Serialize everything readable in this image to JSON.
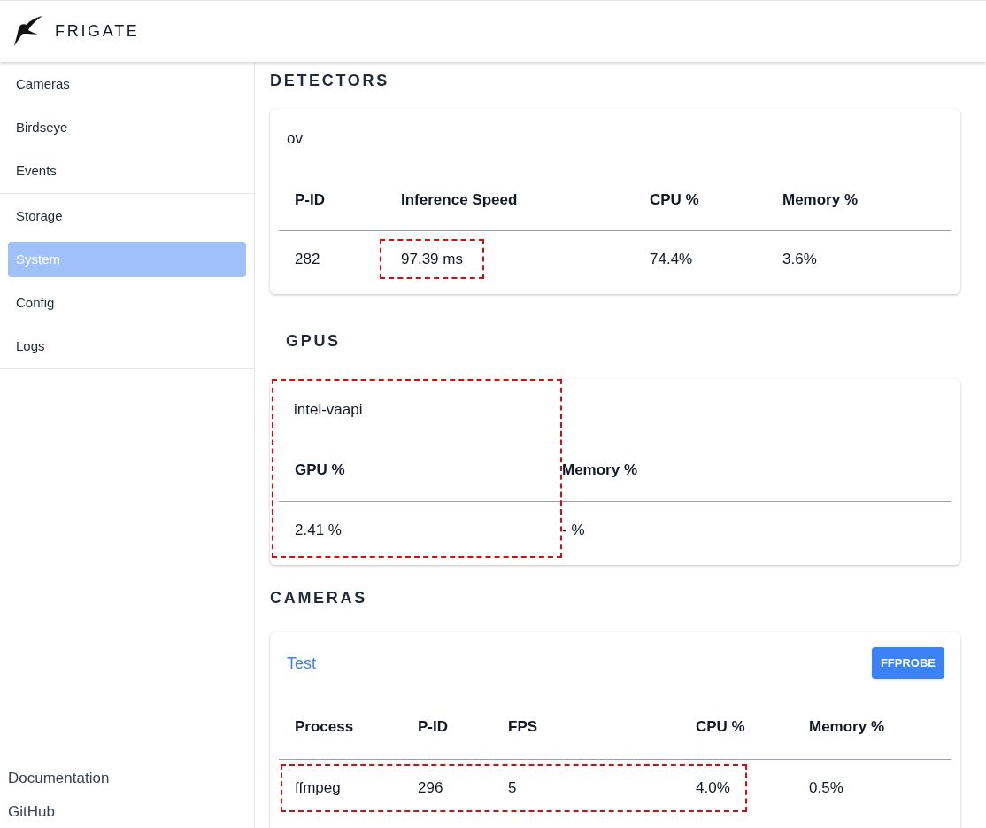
{
  "header": {
    "title": "FRIGATE"
  },
  "sidebar": {
    "groups": [
      [
        {
          "label": "Cameras",
          "selected": false
        },
        {
          "label": "Birdseye",
          "selected": false
        },
        {
          "label": "Events",
          "selected": false
        }
      ],
      [
        {
          "label": "Storage",
          "selected": false
        },
        {
          "label": "System",
          "selected": true
        },
        {
          "label": "Config",
          "selected": false
        },
        {
          "label": "Logs",
          "selected": false
        }
      ]
    ],
    "footer_links": [
      "Documentation",
      "GitHub"
    ]
  },
  "detectors": {
    "heading": "DETECTORS",
    "cards": [
      {
        "name": "ov",
        "columns": [
          "P-ID",
          "Inference Speed",
          "CPU %",
          "Memory %"
        ],
        "rows": [
          {
            "cells": [
              {
                "text": "282",
                "highlighted": false
              },
              {
                "text": "97.39 ms",
                "highlighted": true
              },
              {
                "text": "74.4%",
                "highlighted": false
              },
              {
                "text": "3.6%",
                "highlighted": false
              }
            ]
          }
        ]
      }
    ]
  },
  "gpus": {
    "heading": "GPUS",
    "cards": [
      {
        "name": "intel-vaapi",
        "highlight_first_column": true,
        "columns": [
          "GPU %",
          "Memory %"
        ],
        "values": [
          "2.41 %",
          "- %"
        ]
      }
    ]
  },
  "cameras": {
    "heading": "CAMERAS",
    "cards": [
      {
        "name": "Test",
        "button": "FFPROBE",
        "columns": [
          "Process",
          "P-ID",
          "FPS",
          "CPU %",
          "Memory %"
        ],
        "rows": [
          {
            "highlighted": true,
            "cells": [
              "ffmpeg",
              "296",
              "5",
              "4.0%",
              "0.5%"
            ]
          }
        ]
      }
    ]
  }
}
